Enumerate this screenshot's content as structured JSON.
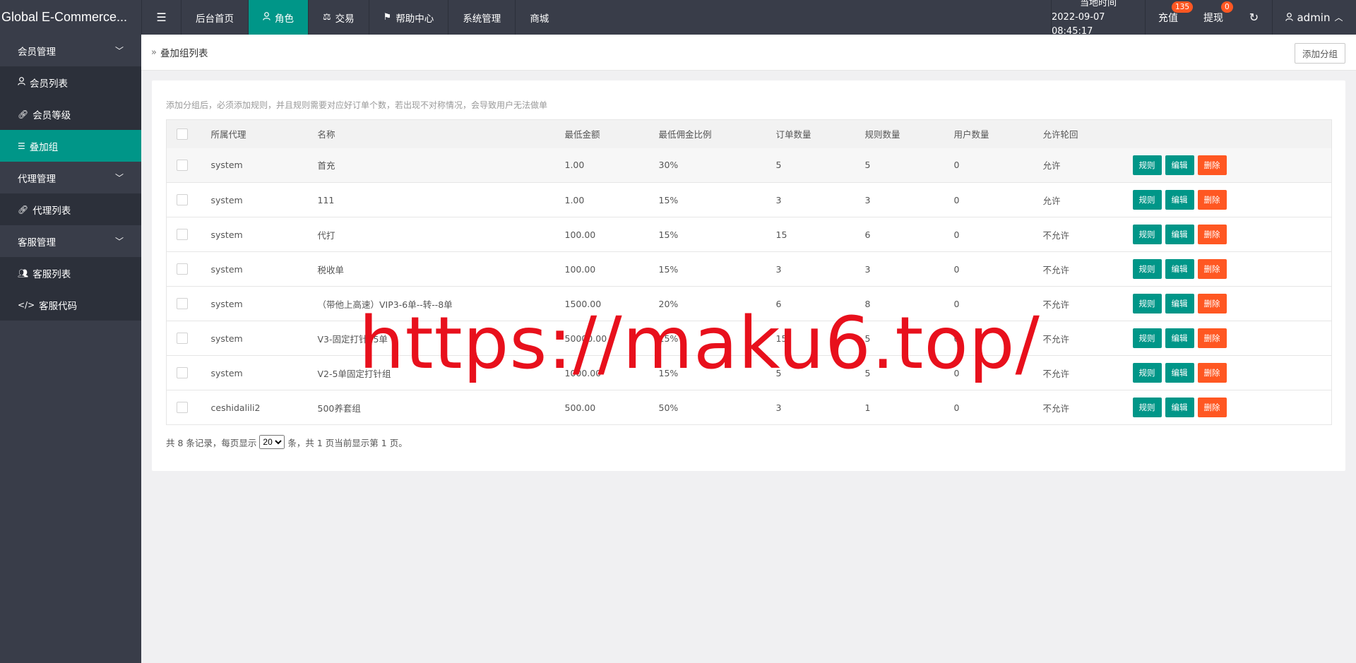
{
  "app": {
    "title": "Global E-Commerce..."
  },
  "topnav": {
    "toggle_icon": "menu-icon",
    "items": [
      {
        "label": "后台首页",
        "icon": ""
      },
      {
        "label": "角色",
        "icon": "user-icon"
      },
      {
        "label": "交易",
        "icon": "scale-icon"
      },
      {
        "label": "帮助中心",
        "icon": "flag-icon"
      },
      {
        "label": "系统管理",
        "icon": ""
      },
      {
        "label": "商城",
        "icon": ""
      }
    ],
    "active_index": 1
  },
  "header_right": {
    "clock_label": "当地时间",
    "clock_value": "2022-09-07 08:45:17",
    "recharge_label": "充值",
    "recharge_badge": "135",
    "withdraw_label": "提现",
    "withdraw_badge": "0",
    "refresh_icon": "refresh-icon",
    "user_label": "admin"
  },
  "sidebar": {
    "groups": [
      {
        "label": "会员管理",
        "items": [
          {
            "label": "会员列表",
            "icon": "user-icon"
          },
          {
            "label": "会员等级",
            "icon": "link-icon"
          },
          {
            "label": "叠加组",
            "icon": "list-icon",
            "active": true
          }
        ]
      },
      {
        "label": "代理管理",
        "items": [
          {
            "label": "代理列表",
            "icon": "link-icon"
          }
        ]
      },
      {
        "label": "客服管理",
        "items": [
          {
            "label": "客服列表",
            "icon": "users-icon"
          },
          {
            "label": "客服代码",
            "icon": "code-icon"
          }
        ]
      }
    ]
  },
  "breadcrumb": {
    "title": "叠加组列表",
    "add_button": "添加分组"
  },
  "tip": "添加分组后，必须添加规则，并且规则需要对应好订单个数，若出现不对称情况，会导致用户无法做单",
  "table": {
    "headers": [
      "所属代理",
      "名称",
      "最低金额",
      "最低佣金比例",
      "订单数量",
      "规则数量",
      "用户数量",
      "允许轮回"
    ],
    "rows": [
      [
        "system",
        "首充",
        "1.00",
        "30%",
        "5",
        "5",
        "0",
        "允许"
      ],
      [
        "system",
        "111",
        "1.00",
        "15%",
        "3",
        "3",
        "0",
        "允许"
      ],
      [
        "system",
        "代打",
        "100.00",
        "15%",
        "15",
        "6",
        "0",
        "不允许"
      ],
      [
        "system",
        "税收单",
        "100.00",
        "15%",
        "3",
        "3",
        "0",
        "不允许"
      ],
      [
        "system",
        "（带他上高速）VIP3-6单--转--8单",
        "1500.00",
        "20%",
        "6",
        "8",
        "0",
        "不允许"
      ],
      [
        "system",
        "V3-固定打针15单",
        "50000.00",
        "15%",
        "15",
        "5",
        "0",
        "不允许"
      ],
      [
        "system",
        "V2-5单固定打针组",
        "1000.00",
        "15%",
        "5",
        "5",
        "0",
        "不允许"
      ],
      [
        "ceshidalili2",
        "500养套组",
        "500.00",
        "50%",
        "3",
        "1",
        "0",
        "不允许"
      ]
    ],
    "actions": {
      "rules": "规则",
      "edit": "编辑",
      "delete": "删除"
    }
  },
  "pager": {
    "prefix": "共 8 条记录，每页显示",
    "page_size": "20",
    "suffix": "条，共 1 页当前显示第 1 页。"
  },
  "watermark": "https://maku6.top/",
  "colors": {
    "topbar": "#393d49",
    "accent": "#009688",
    "danger": "#ff5722"
  }
}
